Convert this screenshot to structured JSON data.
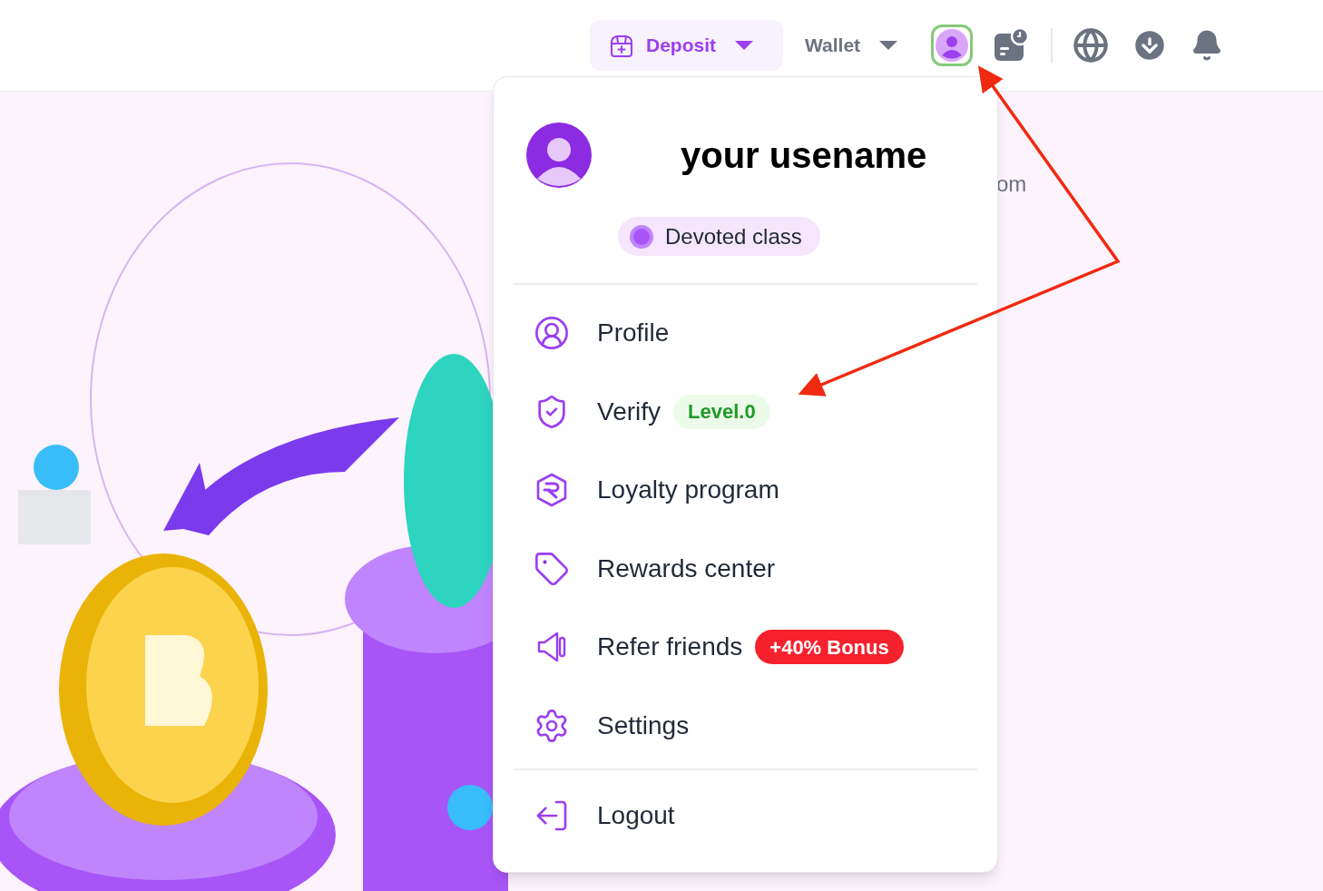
{
  "header": {
    "deposit": {
      "label": "Deposit"
    },
    "wallet": {
      "label": "Wallet"
    },
    "avatar_highlighted": true
  },
  "hero": {
    "text_fragment": "om"
  },
  "account_menu": {
    "username": "your usename",
    "class_badge": "Devoted class",
    "items": [
      {
        "label": "Profile"
      },
      {
        "label": "Verify",
        "badge": {
          "text": "Level.0",
          "kind": "success"
        }
      },
      {
        "label": "Loyalty program"
      },
      {
        "label": "Rewards center"
      },
      {
        "label": "Refer friends",
        "badge": {
          "text": "+40% Bonus",
          "kind": "danger"
        }
      },
      {
        "label": "Settings"
      }
    ],
    "logout": {
      "label": "Logout"
    }
  }
}
